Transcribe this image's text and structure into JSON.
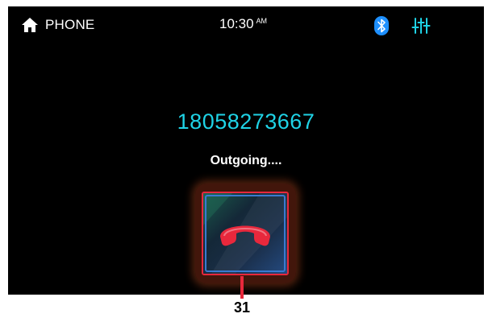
{
  "status_bar": {
    "home_label": "PHONE",
    "time": "10:30",
    "ampm": "AM",
    "icons": [
      "home-icon",
      "bluetooth-icon",
      "equalizer-icon"
    ]
  },
  "call": {
    "number": "18058273667",
    "status": "Outgoing...."
  },
  "end_call_button": {
    "icon": "phone-hangup-icon",
    "callout": "31"
  },
  "colors": {
    "number": "#1fd3e6",
    "accent_blue": "#1e90ff",
    "end_call": "#e8283c",
    "background": "#000000"
  }
}
